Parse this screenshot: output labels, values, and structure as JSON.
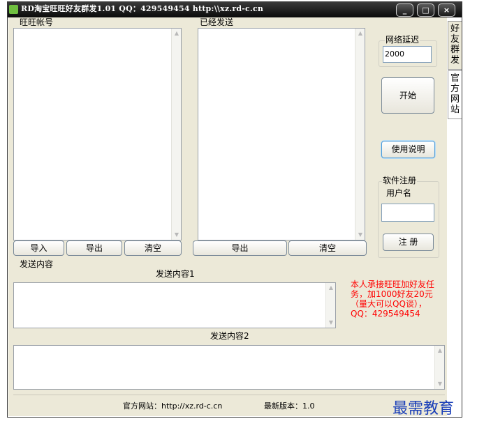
{
  "window": {
    "title": "RD淘宝旺旺好友群发1.01 QQ：429549454 http:\\\\xz.rd-c.cn",
    "controls": {
      "minimize": "_",
      "maximize": "□",
      "close": "×"
    }
  },
  "side_tabs": [
    {
      "label": "好友群发",
      "chars": [
        "好",
        "友",
        "群",
        "发"
      ]
    },
    {
      "label": "官方网站",
      "chars": [
        "官",
        "方",
        "网",
        "站"
      ]
    }
  ],
  "accounts_panel": {
    "label": "旺旺帐号",
    "buttons": {
      "import": "导入",
      "export": "导出",
      "clear": "清空"
    }
  },
  "sent_panel": {
    "label": "已经发送",
    "buttons": {
      "export": "导出",
      "clear": "清空"
    }
  },
  "delay": {
    "label": "网络延迟",
    "value": "2000"
  },
  "start_button": "开始",
  "help_button": "使用说明",
  "registration": {
    "group_label": "软件注册",
    "username_label": "用户名",
    "username_value": "",
    "register_button": "注  册"
  },
  "send_content": {
    "section_label": "发送内容",
    "content1_label": "发送内容1",
    "content1_value": "",
    "content2_label": "发送内容2",
    "content2_value": ""
  },
  "promo_text": "本人承接旺旺加好友任务，加1000好友20元（量大可以QQ谈），QQ：429549454",
  "status_bar": {
    "website": "官方网站：http://xz.rd-c.cn",
    "version": "最新版本：1.0"
  },
  "watermark": "最需教育",
  "colors": {
    "client_bg": "#ece9d8",
    "titlebar": "#1a1a1a",
    "promo": "#ff0000",
    "watermark": "#1a3fb8"
  }
}
